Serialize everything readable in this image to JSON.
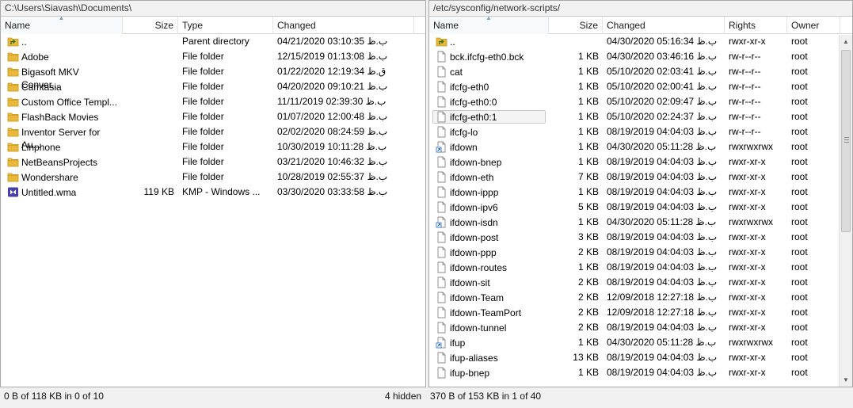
{
  "left": {
    "path": "C:\\Users\\Siavash\\Documents\\",
    "columns": {
      "name": "Name",
      "size": "Size",
      "type": "Type",
      "changed": "Changed"
    },
    "rows": [
      {
        "name": "..",
        "size": "",
        "type": "Parent directory",
        "changed": "04/21/2020  03:10:35 ب.ظ",
        "icon": "parent-folder-icon"
      },
      {
        "name": "Adobe",
        "size": "",
        "type": "File folder",
        "changed": "12/15/2019  01:13:08 ب.ظ",
        "icon": "folder-icon"
      },
      {
        "name": "Bigasoft MKV Conver...",
        "size": "",
        "type": "File folder",
        "changed": "01/22/2020  12:19:34 ق.ظ",
        "icon": "folder-icon"
      },
      {
        "name": "Camtasia",
        "size": "",
        "type": "File folder",
        "changed": "04/20/2020  09:10:21 ب.ظ",
        "icon": "folder-icon"
      },
      {
        "name": "Custom Office Templ...",
        "size": "",
        "type": "File folder",
        "changed": "11/11/2019  02:39:30 ب.ظ",
        "icon": "folder-icon"
      },
      {
        "name": "FlashBack Movies",
        "size": "",
        "type": "File folder",
        "changed": "01/07/2020  12:00:48 ب.ظ",
        "icon": "folder-icon"
      },
      {
        "name": "Inventor Server for Au...",
        "size": "",
        "type": "File folder",
        "changed": "02/02/2020  08:24:59 ب.ظ",
        "icon": "folder-icon"
      },
      {
        "name": "Linphone",
        "size": "",
        "type": "File folder",
        "changed": "10/30/2019  10:11:28 ب.ظ",
        "icon": "folder-icon"
      },
      {
        "name": "NetBeansProjects",
        "size": "",
        "type": "File folder",
        "changed": "03/21/2020  10:46:32 ب.ظ",
        "icon": "folder-icon"
      },
      {
        "name": "Wondershare",
        "size": "",
        "type": "File folder",
        "changed": "10/28/2019  02:55:37 ب.ظ",
        "icon": "folder-icon"
      },
      {
        "name": "Untitled.wma",
        "size": "119 KB",
        "type": "KMP - Windows ...",
        "changed": "03/30/2020  03:33:58 ب.ظ",
        "icon": "media-file-icon"
      }
    ],
    "status": "0 B of 118 KB in 0 of 10",
    "hidden": "4 hidden"
  },
  "right": {
    "path": "/etc/sysconfig/network-scripts/",
    "columns": {
      "name": "Name",
      "size": "Size",
      "changed": "Changed",
      "rights": "Rights",
      "owner": "Owner"
    },
    "rows": [
      {
        "name": "..",
        "size": "",
        "changed": "04/30/2020  05:16:34 ب.ظ",
        "rights": "rwxr-xr-x",
        "owner": "root",
        "icon": "parent-folder-icon"
      },
      {
        "name": "bck.ifcfg-eth0.bck",
        "size": "1 KB",
        "changed": "04/30/2020  03:46:16 ب.ظ",
        "rights": "rw-r--r--",
        "owner": "root",
        "icon": "file-icon"
      },
      {
        "name": "cat",
        "size": "1 KB",
        "changed": "05/10/2020  02:03:41 ب.ظ",
        "rights": "rw-r--r--",
        "owner": "root",
        "icon": "file-icon"
      },
      {
        "name": "ifcfg-eth0",
        "size": "1 KB",
        "changed": "05/10/2020  02:00:41 ب.ظ",
        "rights": "rw-r--r--",
        "owner": "root",
        "icon": "file-icon"
      },
      {
        "name": "ifcfg-eth0:0",
        "size": "1 KB",
        "changed": "05/10/2020  02:09:47 ب.ظ",
        "rights": "rw-r--r--",
        "owner": "root",
        "icon": "file-icon"
      },
      {
        "name": "ifcfg-eth0:1",
        "size": "1 KB",
        "changed": "05/10/2020  02:24:37 ب.ظ",
        "rights": "rw-r--r--",
        "owner": "root",
        "icon": "file-icon",
        "focused": true
      },
      {
        "name": "ifcfg-lo",
        "size": "1 KB",
        "changed": "08/19/2019  04:04:03 ب.ظ",
        "rights": "rw-r--r--",
        "owner": "root",
        "icon": "file-icon"
      },
      {
        "name": "ifdown",
        "size": "1 KB",
        "changed": "04/30/2020  05:11:28 ب.ظ",
        "rights": "rwxrwxrwx",
        "owner": "root",
        "icon": "shortcut-file-icon"
      },
      {
        "name": "ifdown-bnep",
        "size": "1 KB",
        "changed": "08/19/2019  04:04:03 ب.ظ",
        "rights": "rwxr-xr-x",
        "owner": "root",
        "icon": "file-icon"
      },
      {
        "name": "ifdown-eth",
        "size": "7 KB",
        "changed": "08/19/2019  04:04:03 ب.ظ",
        "rights": "rwxr-xr-x",
        "owner": "root",
        "icon": "file-icon"
      },
      {
        "name": "ifdown-ippp",
        "size": "1 KB",
        "changed": "08/19/2019  04:04:03 ب.ظ",
        "rights": "rwxr-xr-x",
        "owner": "root",
        "icon": "file-icon"
      },
      {
        "name": "ifdown-ipv6",
        "size": "5 KB",
        "changed": "08/19/2019  04:04:03 ب.ظ",
        "rights": "rwxr-xr-x",
        "owner": "root",
        "icon": "file-icon"
      },
      {
        "name": "ifdown-isdn",
        "size": "1 KB",
        "changed": "04/30/2020  05:11:28 ب.ظ",
        "rights": "rwxrwxrwx",
        "owner": "root",
        "icon": "shortcut-file-icon"
      },
      {
        "name": "ifdown-post",
        "size": "3 KB",
        "changed": "08/19/2019  04:04:03 ب.ظ",
        "rights": "rwxr-xr-x",
        "owner": "root",
        "icon": "file-icon"
      },
      {
        "name": "ifdown-ppp",
        "size": "2 KB",
        "changed": "08/19/2019  04:04:03 ب.ظ",
        "rights": "rwxr-xr-x",
        "owner": "root",
        "icon": "file-icon"
      },
      {
        "name": "ifdown-routes",
        "size": "1 KB",
        "changed": "08/19/2019  04:04:03 ب.ظ",
        "rights": "rwxr-xr-x",
        "owner": "root",
        "icon": "file-icon"
      },
      {
        "name": "ifdown-sit",
        "size": "2 KB",
        "changed": "08/19/2019  04:04:03 ب.ظ",
        "rights": "rwxr-xr-x",
        "owner": "root",
        "icon": "file-icon"
      },
      {
        "name": "ifdown-Team",
        "size": "2 KB",
        "changed": "12/09/2018  12:27:18 ب.ظ",
        "rights": "rwxr-xr-x",
        "owner": "root",
        "icon": "file-icon"
      },
      {
        "name": "ifdown-TeamPort",
        "size": "2 KB",
        "changed": "12/09/2018  12:27:18 ب.ظ",
        "rights": "rwxr-xr-x",
        "owner": "root",
        "icon": "file-icon"
      },
      {
        "name": "ifdown-tunnel",
        "size": "2 KB",
        "changed": "08/19/2019  04:04:03 ب.ظ",
        "rights": "rwxr-xr-x",
        "owner": "root",
        "icon": "file-icon"
      },
      {
        "name": "ifup",
        "size": "1 KB",
        "changed": "04/30/2020  05:11:28 ب.ظ",
        "rights": "rwxrwxrwx",
        "owner": "root",
        "icon": "shortcut-file-icon"
      },
      {
        "name": "ifup-aliases",
        "size": "13 KB",
        "changed": "08/19/2019  04:04:03 ب.ظ",
        "rights": "rwxr-xr-x",
        "owner": "root",
        "icon": "file-icon"
      },
      {
        "name": "ifup-bnep",
        "size": "1 KB",
        "changed": "08/19/2019  04:04:03 ب.ظ",
        "rights": "rwxr-xr-x",
        "owner": "root",
        "icon": "file-icon"
      }
    ],
    "status": "370 B of 153 KB in 1 of 40"
  },
  "colors": {
    "folder": "#e8b93a",
    "folder_dark": "#c99420",
    "media": "#4a3fa8",
    "shortcut": "#2b6cc4"
  }
}
